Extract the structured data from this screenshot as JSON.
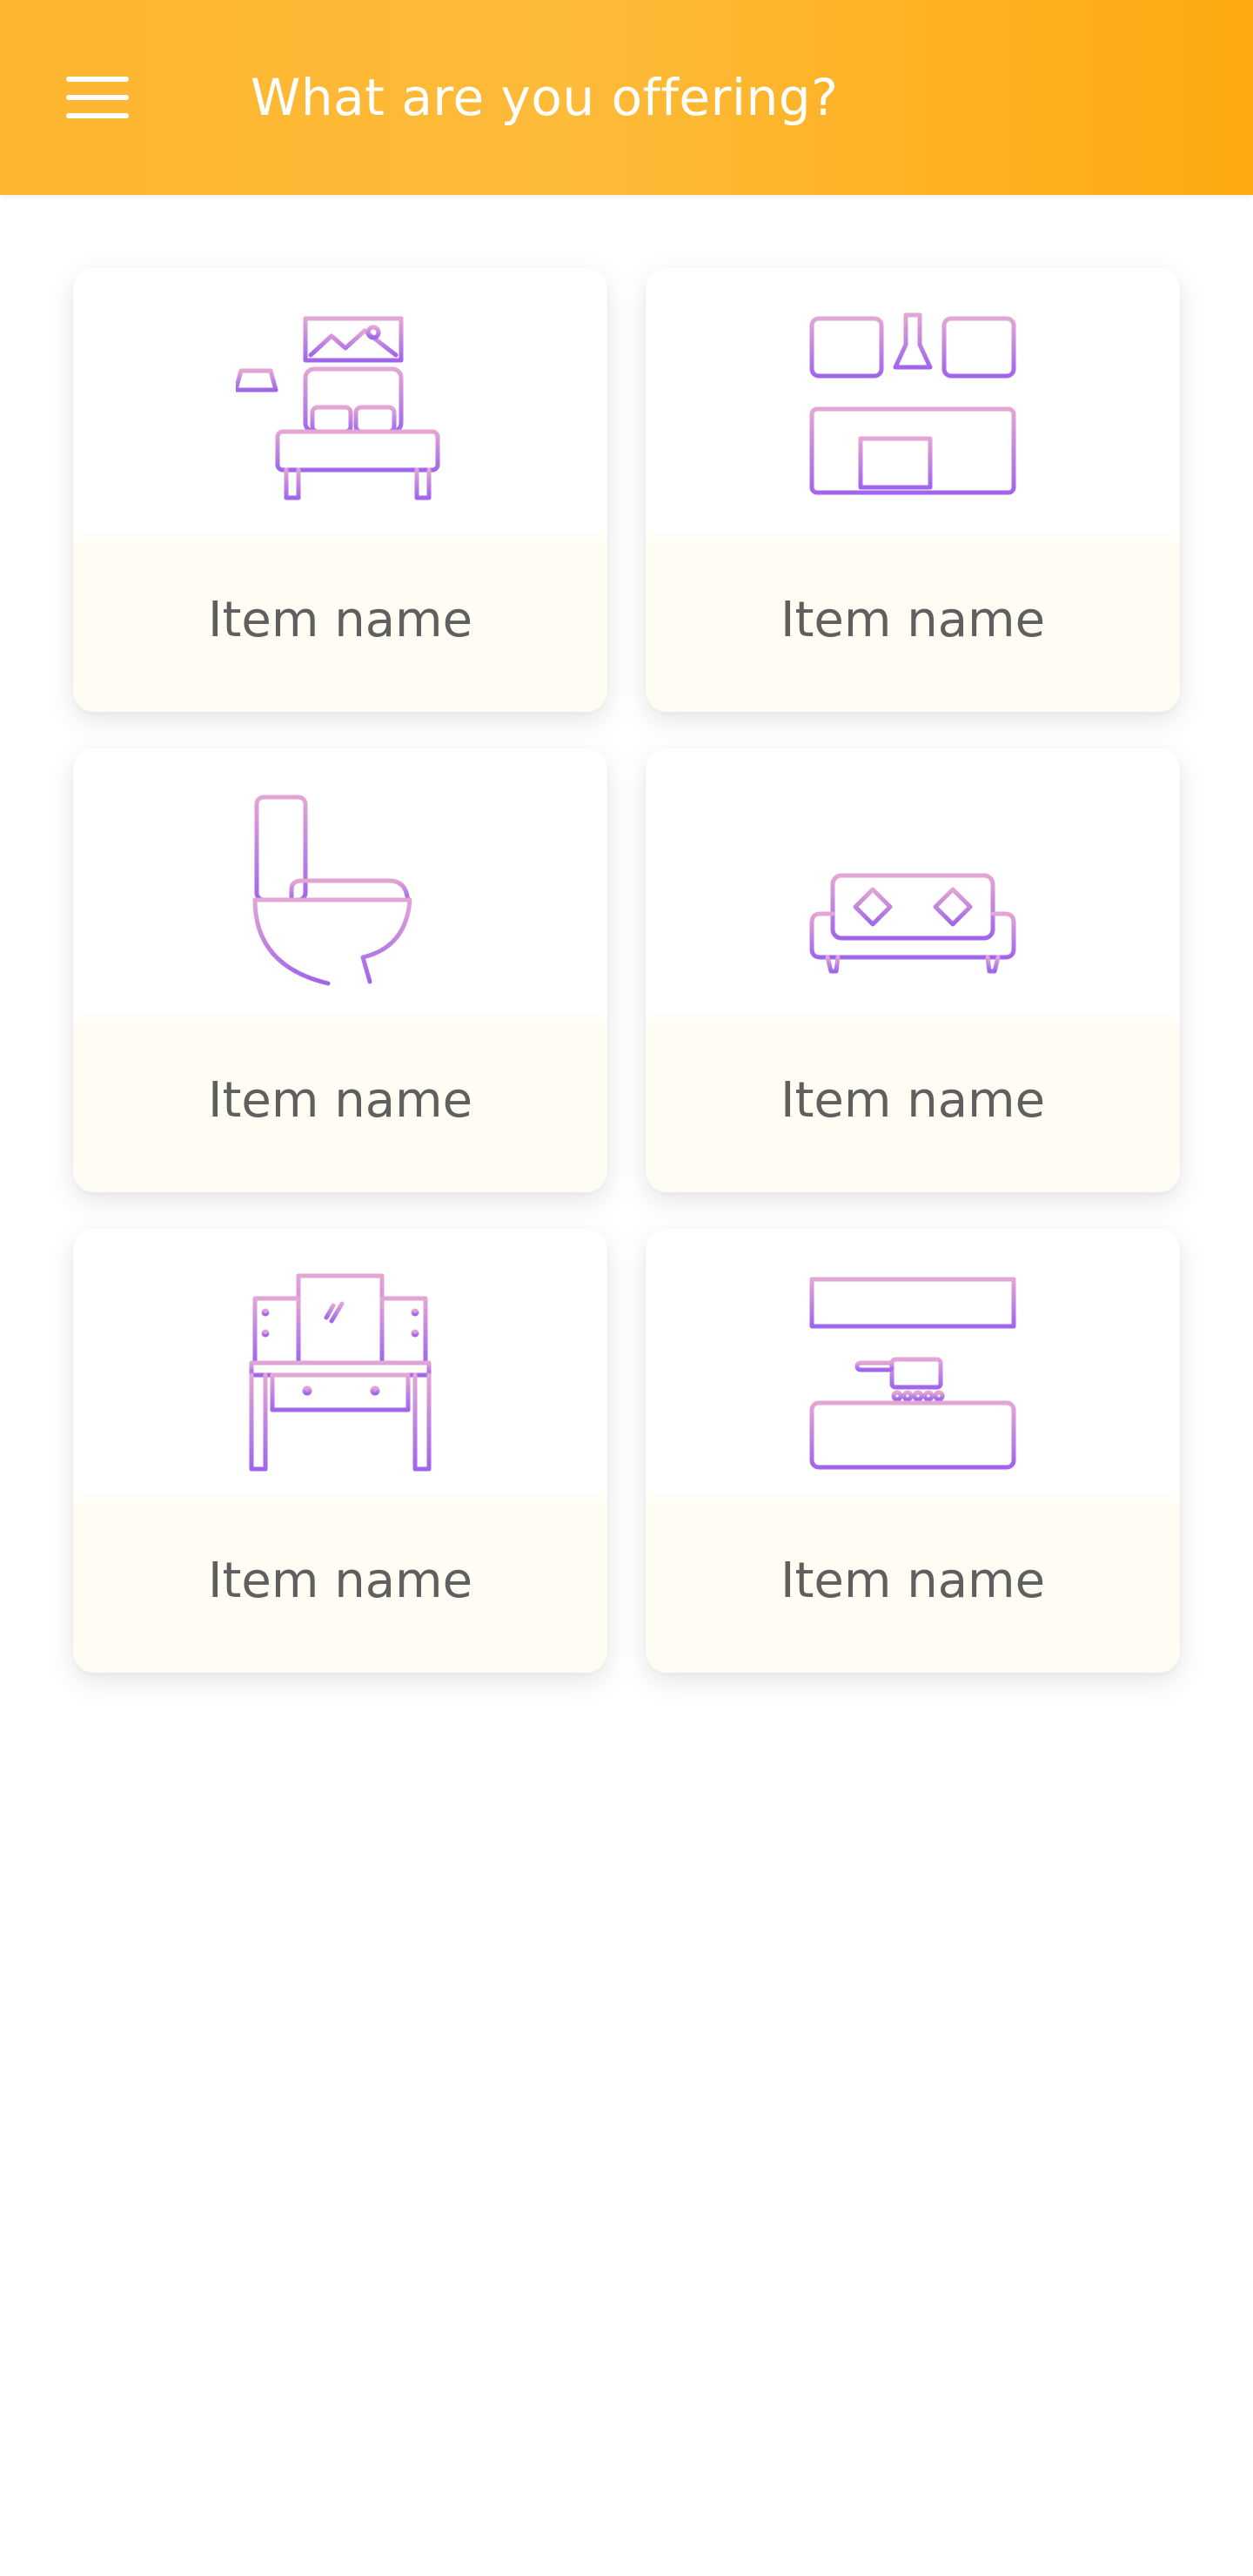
{
  "header": {
    "title": "What are you offering?",
    "menu_icon": "hamburger-menu-icon",
    "background_from": "#fdb52f",
    "background_to": "#fea90f"
  },
  "categories": [
    {
      "icon": "bedroom-icon",
      "label": "Item name"
    },
    {
      "icon": "kitchen-cabinet-icon",
      "label": "Item name"
    },
    {
      "icon": "toilet-icon",
      "label": "Item name"
    },
    {
      "icon": "sofa-icon",
      "label": "Item name"
    },
    {
      "icon": "dressing-table-icon",
      "label": "Item name"
    },
    {
      "icon": "kitchen-stove-icon",
      "label": "Item name"
    }
  ],
  "colors": {
    "icon_top": "#e3a6d4",
    "icon_bottom": "#a065ec",
    "label_text": "#5f5f5f"
  }
}
